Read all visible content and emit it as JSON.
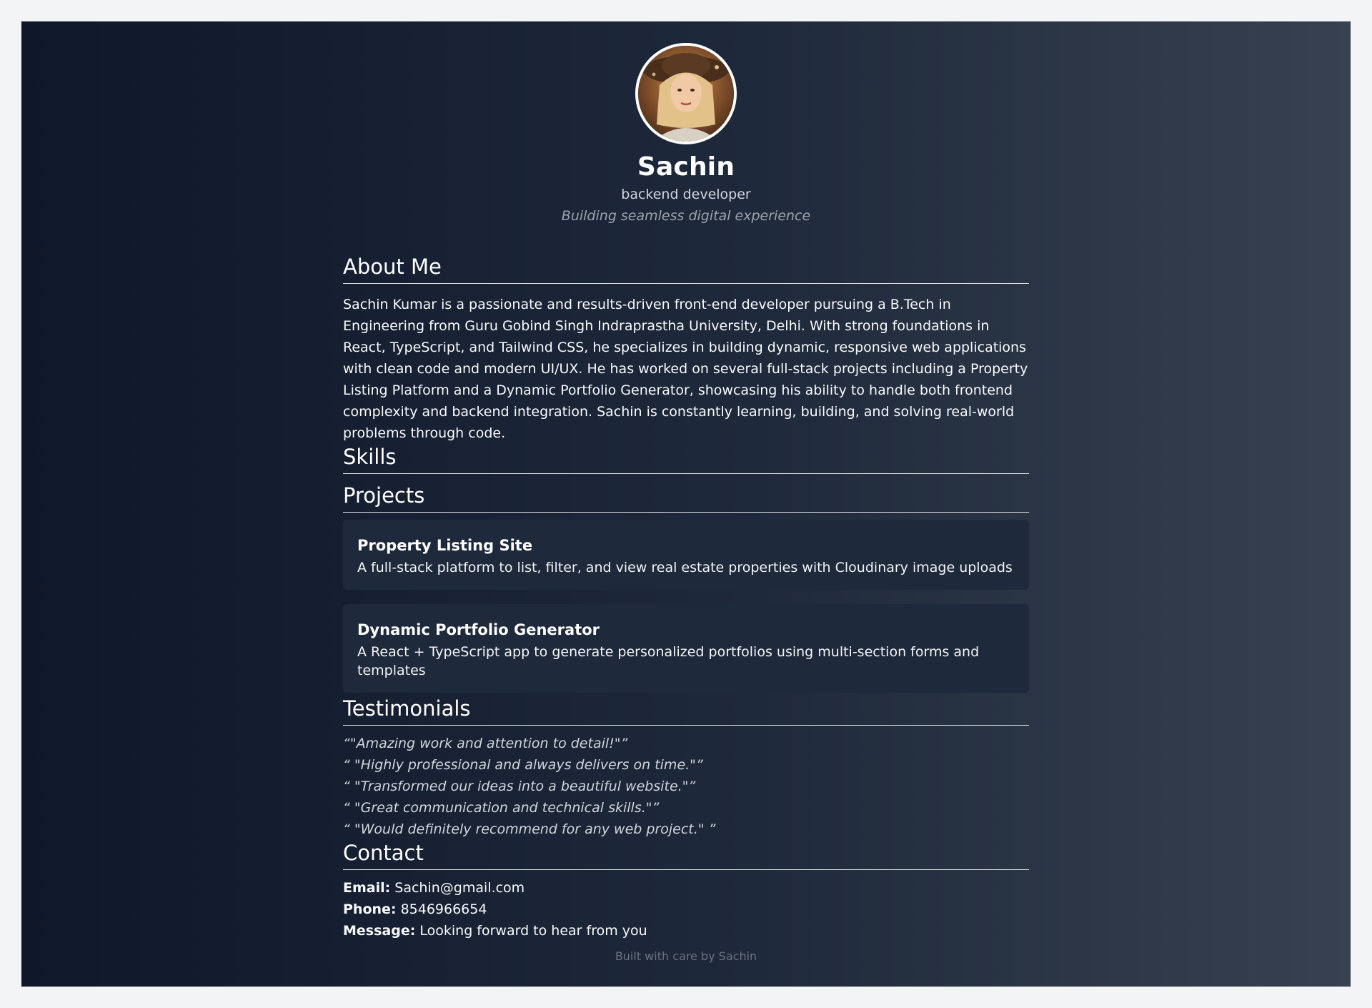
{
  "profile": {
    "name": "Sachin",
    "role": "backend developer",
    "tagline": "Building seamless digital experience"
  },
  "about": {
    "title": "About Me",
    "text": "Sachin Kumar is a passionate and results-driven front-end developer pursuing a B.Tech in Engineering from Guru Gobind Singh Indraprastha University, Delhi. With strong foundations in React, TypeScript, and Tailwind CSS, he specializes in building dynamic, responsive web applications with clean code and modern UI/UX. He has worked on several full-stack projects including a Property Listing Platform and a Dynamic Portfolio Generator, showcasing his ability to handle both frontend complexity and backend integration. Sachin is constantly learning, building, and solving real-world problems through code."
  },
  "skills": {
    "title": "Skills"
  },
  "projects": {
    "title": "Projects",
    "items": [
      {
        "title": "Property Listing Site",
        "description": "A full-stack platform to list, filter, and view real estate properties with Cloudinary image uploads"
      },
      {
        "title": "Dynamic Portfolio Generator",
        "description": "A React + TypeScript app to generate personalized portfolios using multi-section forms and templates"
      }
    ]
  },
  "testimonials": {
    "title": "Testimonials",
    "items": [
      "“\"Amazing work and attention to detail!\"”",
      "“ \"Highly professional and always delivers on time.\"”",
      "“ \"Transformed our ideas into a beautiful website.\"”",
      "“ \"Great communication and technical skills.\"”",
      "“ \"Would definitely recommend for any web project.\" ”"
    ]
  },
  "contact": {
    "title": "Contact",
    "email_label": "Email:",
    "email": "Sachin@gmail.com",
    "phone_label": "Phone:",
    "phone": "8546966654",
    "message_label": "Message:",
    "message": "Looking forward to hear from you"
  },
  "footer": {
    "text": "Built with care by Sachin"
  }
}
